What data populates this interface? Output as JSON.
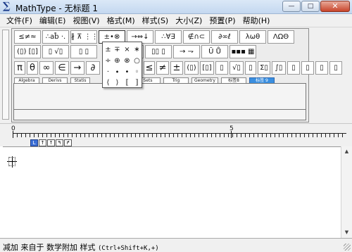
{
  "window": {
    "title": "MathType - 无标题 1",
    "icon": "sigma-icon",
    "controls": {
      "minimize": "—",
      "maximize": "□",
      "close": "✕"
    }
  },
  "menu": [
    {
      "label": "文件(F)"
    },
    {
      "label": "编辑(E)"
    },
    {
      "label": "视图(V)"
    },
    {
      "label": "格式(M)"
    },
    {
      "label": "样式(S)"
    },
    {
      "label": "大小(Z)"
    },
    {
      "label": "预置(P)"
    },
    {
      "label": "帮助(H)"
    }
  ],
  "toolbar": {
    "row1": [
      {
        "label": "≤≠≈",
        "name": "relations-palette"
      },
      {
        "label": "∴ab̊ ·.",
        "name": "spaces-palette"
      },
      {
        "label": "∦ ⊼ ⋮⋮",
        "name": "embellishments-palette"
      },
      {
        "label": "±•⊗",
        "name": "operators-palette",
        "pressed": true
      },
      {
        "label": "→⇔↓",
        "name": "arrows-palette"
      },
      {
        "label": "∴∀∃",
        "name": "logic-palette"
      },
      {
        "label": "∉∩⊂",
        "name": "sets-palette"
      },
      {
        "label": "∂∞ℓ",
        "name": "misc-palette"
      },
      {
        "label": "λωθ",
        "name": "greek-lower-palette"
      },
      {
        "label": "ΛΩΘ",
        "name": "greek-upper-palette"
      }
    ],
    "row2": [
      {
        "label": "(▯) [▯]",
        "name": "fences-palette"
      },
      {
        "label": "▯ √▯",
        "name": "fractions-palette"
      },
      {
        "label": "▯ ▯",
        "name": "scripts-palette"
      },
      {
        "label": "",
        "name": "sums-palette"
      },
      {
        "label": "",
        "name": "integrals-palette"
      },
      {
        "label": "▯▯ ▯",
        "name": "underbars-palette"
      },
      {
        "label": "→ ⇁",
        "name": "labeled-arrows-palette"
      },
      {
        "label": "Ū Ů",
        "name": "products-palette"
      },
      {
        "label": "▪▪▪ ▦",
        "name": "matrices-palette"
      }
    ],
    "row3": [
      {
        "label": "π"
      },
      {
        "label": "θ"
      },
      {
        "label": "∞"
      },
      {
        "label": "∈"
      },
      {
        "label": "→"
      },
      {
        "label": "∂"
      },
      {
        "label": "≤"
      },
      {
        "label": "≠"
      },
      {
        "label": "±"
      },
      {
        "label": "(▯)"
      },
      {
        "label": "[▯]"
      },
      {
        "label": "▯"
      },
      {
        "label": "√▯"
      },
      {
        "label": "▯"
      },
      {
        "label": "Σ▯"
      },
      {
        "label": "∫▯"
      },
      {
        "label": "▯"
      },
      {
        "label": "▯"
      },
      {
        "label": "▯"
      },
      {
        "label": "▯"
      }
    ]
  },
  "operators_popup": {
    "symbols": [
      "±",
      "∓",
      "×",
      "∗",
      "÷",
      "⊕",
      "⊗",
      "○",
      "·",
      "∙",
      "•",
      "◦",
      "⟨",
      "⟩",
      "⟦",
      "⟧"
    ]
  },
  "tabs": [
    {
      "label": "Algebra"
    },
    {
      "label": "Derivs"
    },
    {
      "label": "Statis"
    },
    {
      "label": "Sets"
    },
    {
      "label": "Trig"
    },
    {
      "label": "Geometry"
    },
    {
      "label": "标签8"
    },
    {
      "label": "标签 9",
      "active": true
    }
  ],
  "ruler": {
    "numbers": [
      "0",
      "5"
    ]
  },
  "alignment_buttons": [
    "L",
    "↑",
    "↑",
    "↰",
    "↱"
  ],
  "status": {
    "prefix": "减加 来自于 数学附加 样式 ",
    "shortcut": "(Ctrl+Shift+K,+)"
  }
}
